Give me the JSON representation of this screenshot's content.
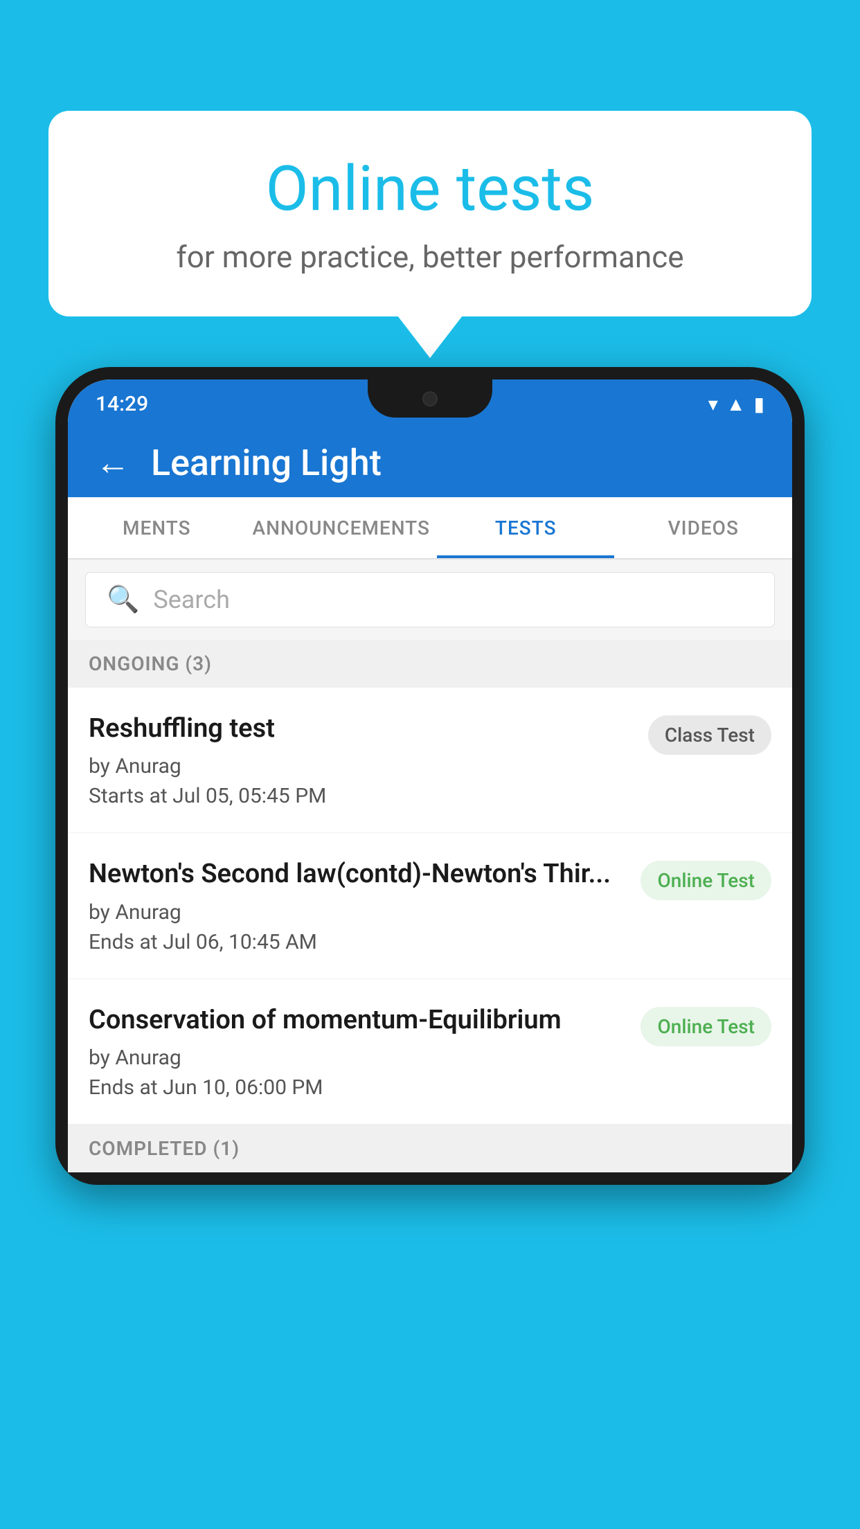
{
  "background_color": "#1BBDE8",
  "speech_bubble": {
    "title": "Online tests",
    "subtitle": "for more practice, better performance"
  },
  "phone": {
    "status_bar": {
      "time": "14:29",
      "icons": [
        "wifi",
        "signal",
        "battery"
      ]
    },
    "app_bar": {
      "title": "Learning Light",
      "back_label": "←"
    },
    "tabs": [
      {
        "label": "MENTS",
        "active": false
      },
      {
        "label": "ANNOUNCEMENTS",
        "active": false
      },
      {
        "label": "TESTS",
        "active": true
      },
      {
        "label": "VIDEOS",
        "active": false
      }
    ],
    "search": {
      "placeholder": "Search"
    },
    "section_ongoing": {
      "label": "ONGOING (3)"
    },
    "tests": [
      {
        "title": "Reshuffling test",
        "author": "by Anurag",
        "date_label": "Starts at",
        "date": "Jul 05, 05:45 PM",
        "badge": "Class Test",
        "badge_type": "class"
      },
      {
        "title": "Newton's Second law(contd)-Newton's Thir...",
        "author": "by Anurag",
        "date_label": "Ends at",
        "date": "Jul 06, 10:45 AM",
        "badge": "Online Test",
        "badge_type": "online"
      },
      {
        "title": "Conservation of momentum-Equilibrium",
        "author": "by Anurag",
        "date_label": "Ends at",
        "date": "Jun 10, 06:00 PM",
        "badge": "Online Test",
        "badge_type": "online"
      }
    ],
    "section_completed": {
      "label": "COMPLETED (1)"
    }
  }
}
